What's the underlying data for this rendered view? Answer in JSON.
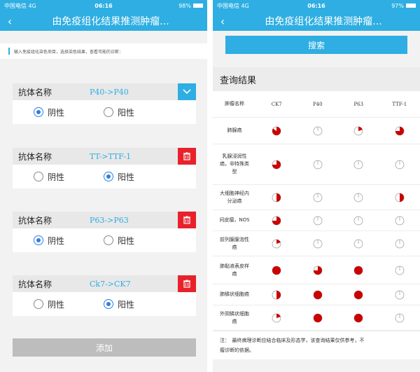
{
  "status_left": {
    "carrier": "中国电信",
    "network": "4G",
    "time": "06:16",
    "battery": "98%",
    "battery_level": 0.98
  },
  "status_right": {
    "carrier": "中国电信",
    "network": "4G",
    "time": "06:16",
    "battery": "97%",
    "battery_level": 0.97
  },
  "nav": {
    "back": "‹",
    "title": "由免疫组化结果推测肿瘤..."
  },
  "left": {
    "notice": "输入免疫组化染色项目，选择染色结果，查看可能的诊断：",
    "antibodies": [
      {
        "label": "抗体名称",
        "value": "P40->P40",
        "action": "dropdown",
        "negative_label": "阴性",
        "positive_label": "阳性",
        "selected": "negative"
      },
      {
        "label": "抗体名称",
        "value": "TT->TTF-1",
        "action": "delete",
        "negative_label": "阴性",
        "positive_label": "阳性",
        "selected": "positive"
      },
      {
        "label": "抗体名称",
        "value": "P63->P63",
        "action": "delete",
        "negative_label": "阴性",
        "positive_label": "阳性",
        "selected": "negative"
      },
      {
        "label": "抗体名称",
        "value": "Ck7->CK7",
        "action": "delete",
        "negative_label": "阴性",
        "positive_label": "阳性",
        "selected": "positive"
      }
    ],
    "add_label": "添加"
  },
  "right": {
    "search_label": "搜索",
    "results_title": "查询结果",
    "table": {
      "headers": [
        "肿瘤名称",
        "CK7",
        "P40",
        "P63",
        "TTF-1"
      ],
      "rows": [
        {
          "name": [
            "肺腺癌"
          ],
          "cells": [
            0.85,
            0.05,
            0.2,
            0.75
          ]
        },
        {
          "name": [
            "乳腺浸润性",
            "癌，非特殊类",
            "型"
          ],
          "cells": [
            0.75,
            0.05,
            0.05,
            0.05
          ]
        },
        {
          "name": [
            "大细胞神经内",
            "分泌癌"
          ],
          "cells": [
            0.5,
            0.05,
            0.05,
            0.5
          ]
        },
        {
          "name": [
            "间皮瘤，NOS"
          ],
          "cells": [
            0.75,
            0.05,
            0.05,
            0.05
          ]
        },
        {
          "name": [
            "前列腺腺泡性",
            "癌"
          ],
          "cells": [
            0.2,
            0.05,
            0.05,
            0.05
          ]
        },
        {
          "name": [
            "肺黏液表皮样",
            "癌"
          ],
          "cells": [
            1.0,
            0.75,
            1.0,
            0.05
          ]
        },
        {
          "name": [
            "肺鳞状细胞癌"
          ],
          "cells": [
            0.5,
            1.0,
            1.0,
            0.05
          ]
        },
        {
          "name": [
            "外阴鳞状细胞",
            "癌"
          ],
          "cells": [
            0.2,
            1.0,
            1.0,
            0.05
          ]
        }
      ]
    },
    "note_line1": "注：　最终病理诊断应结合临床及形态学，该查询结果仅供参考，不",
    "note_line2": "瘤诊断的依据。"
  },
  "colors": {
    "accent": "#2eaee2",
    "delete": "#e8222a",
    "pie": "#cc0000",
    "radio": "#2e7fe0",
    "add_button": "#bdbdbd"
  }
}
